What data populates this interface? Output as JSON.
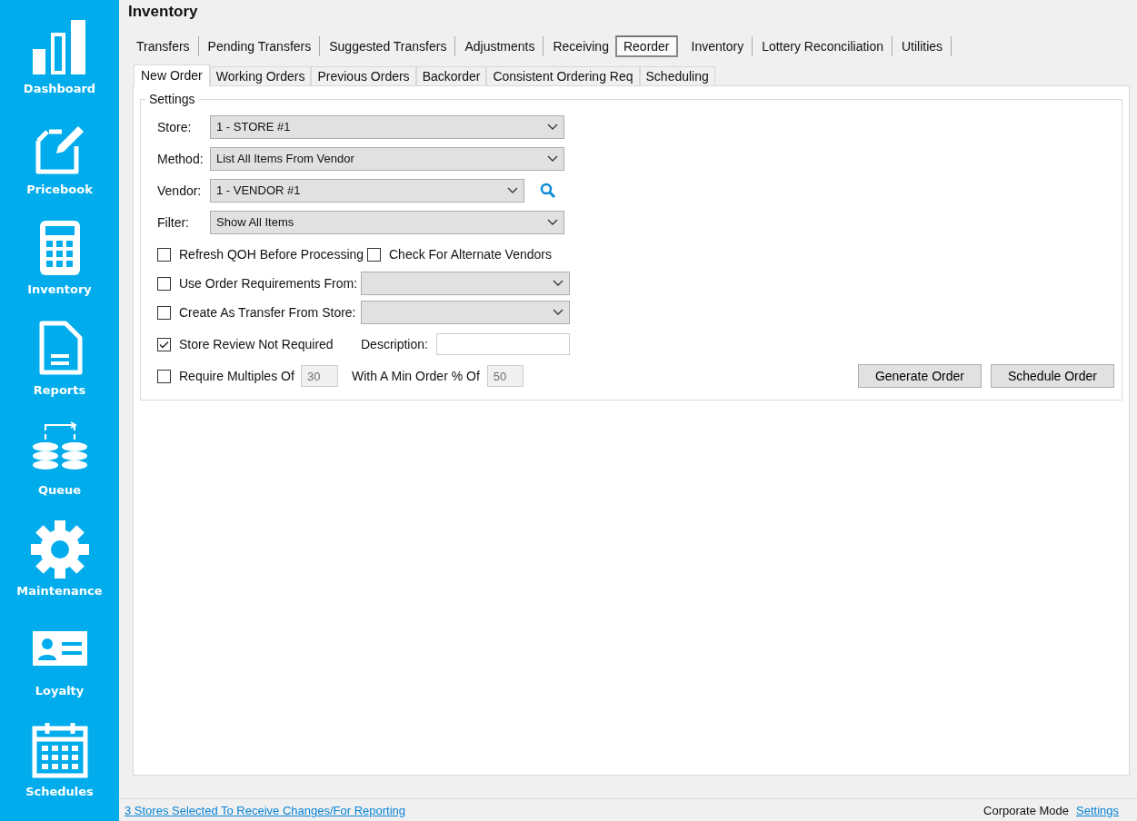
{
  "sidebar": {
    "items": [
      {
        "kind": "dashboard",
        "label": "Dashboard"
      },
      {
        "kind": "pricebook",
        "label": "Pricebook"
      },
      {
        "kind": "inventory",
        "label": "Inventory"
      },
      {
        "kind": "reports",
        "label": "Reports"
      },
      {
        "kind": "queue",
        "label": "Queue"
      },
      {
        "kind": "maintenance",
        "label": "Maintenance"
      },
      {
        "kind": "loyalty",
        "label": "Loyalty"
      },
      {
        "kind": "schedules",
        "label": "Schedules"
      }
    ]
  },
  "header": {
    "title": "Inventory"
  },
  "tabs": [
    {
      "label": "Transfers",
      "selected": false
    },
    {
      "label": "Pending Transfers",
      "selected": false
    },
    {
      "label": "Suggested Transfers",
      "selected": false
    },
    {
      "label": "Adjustments",
      "selected": false
    },
    {
      "label": "Receiving",
      "selected": false
    },
    {
      "label": "Reorder",
      "selected": true
    },
    {
      "label": "Inventory",
      "selected": false
    },
    {
      "label": "Lottery Reconciliation",
      "selected": false
    },
    {
      "label": "Utilities",
      "selected": false
    }
  ],
  "subtabs": [
    {
      "label": "New Order",
      "selected": true
    },
    {
      "label": "Working Orders",
      "selected": false
    },
    {
      "label": "Previous Orders",
      "selected": false
    },
    {
      "label": "Backorder",
      "selected": false
    },
    {
      "label": "Consistent Ordering Req",
      "selected": false
    },
    {
      "label": "Scheduling",
      "selected": false
    }
  ],
  "settings": {
    "title": "Settings",
    "fields": [
      {
        "label": "Store:",
        "value": "1 - STORE #1",
        "search": false
      },
      {
        "label": "Method:",
        "value": "List All Items From Vendor",
        "search": false
      },
      {
        "label": "Vendor:",
        "value": "1 - VENDOR #1",
        "search": true
      },
      {
        "label": "Filter:",
        "value": "Show All Items",
        "search": false
      }
    ],
    "refresh_qoh": {
      "label": "Refresh QOH Before Processing",
      "checked": false
    },
    "alternate_vendors": {
      "label": "Check For Alternate Vendors",
      "checked": false
    },
    "order_requirements": {
      "label": "Use Order Requirements From:",
      "checked": false
    },
    "transfer_from_store": {
      "label": "Create As Transfer From Store:",
      "checked": false
    },
    "review_not_required": {
      "label": "Store Review Not Required",
      "checked": true
    },
    "description": {
      "label": "Description:"
    },
    "require_multiples": {
      "label": "Require Multiples Of",
      "checked": false,
      "value": "30",
      "disabled": true
    },
    "min_order": {
      "label": "With A Min Order % Of",
      "value": "50",
      "disabled": true
    },
    "buttons": [
      "Generate Order",
      "Schedule Order"
    ]
  },
  "status_bar": {
    "stores_link": "3 Stores Selected To Receive Changes/For Reporting",
    "mode": "Corporate Mode",
    "settings_link": "Settings"
  }
}
